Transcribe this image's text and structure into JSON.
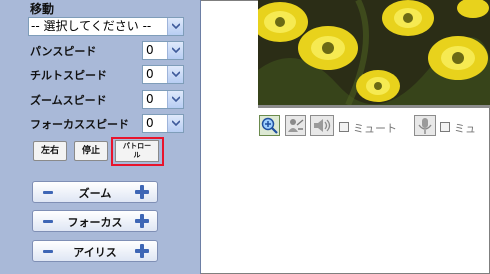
{
  "panel": {
    "move_label": "移動",
    "preset_select": {
      "value": "-- 選択してください --"
    },
    "speeds": [
      {
        "label": "パンスピード",
        "value": "0"
      },
      {
        "label": "チルトスピード",
        "value": "0"
      },
      {
        "label": "ズームスピード",
        "value": "0"
      },
      {
        "label": "フォーカススピード",
        "value": "0"
      }
    ],
    "buttons": {
      "left_right": "左右",
      "stop": "停止",
      "patrol_line1": "パトロー",
      "patrol_line2": "ル"
    },
    "adjust": [
      {
        "label": "ズーム"
      },
      {
        "label": "フォーカス"
      },
      {
        "label": "アイリス"
      }
    ]
  },
  "toolbar": {
    "mute_label_1": "ミュート",
    "mute_label_2": "ミュ"
  },
  "colors": {
    "panel_bg": "#a9b9d8",
    "highlight": "#e8142c",
    "accent_blue": "#3e66b5"
  }
}
